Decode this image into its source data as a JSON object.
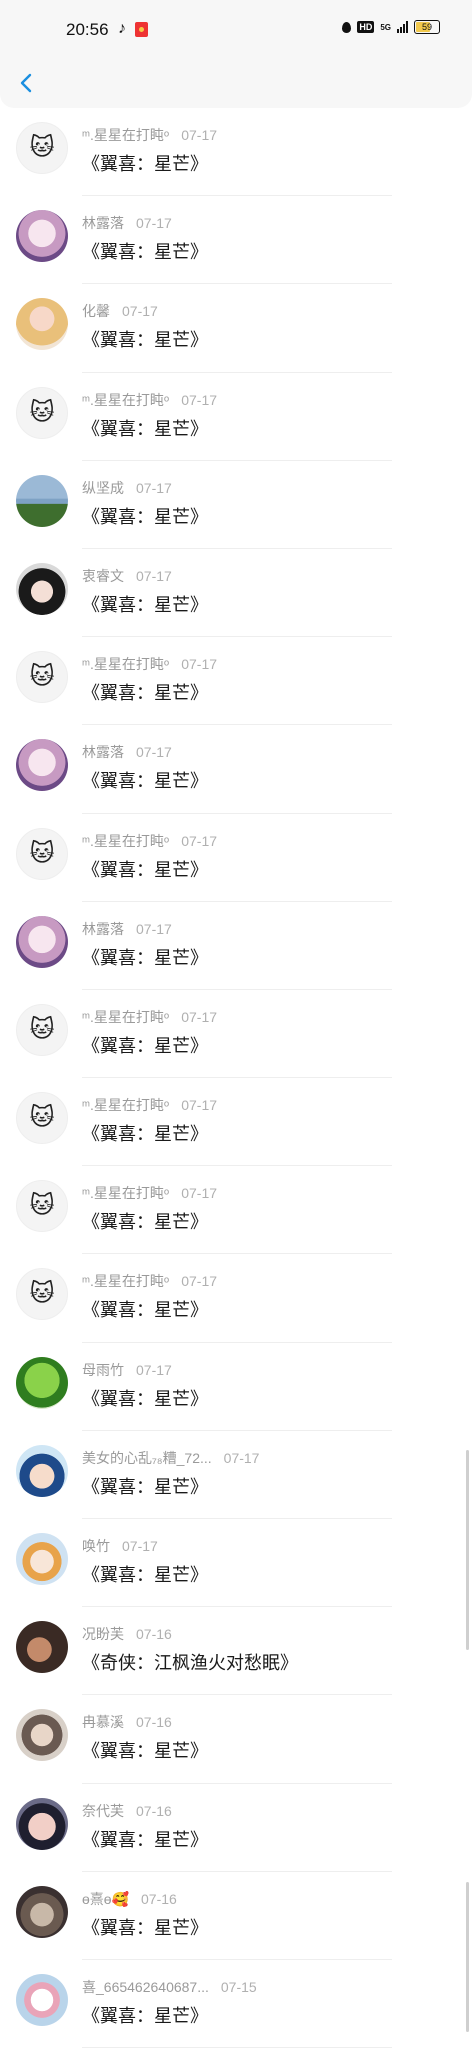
{
  "status_bar": {
    "time": "20:56",
    "hd": "HD",
    "network": "5G",
    "battery": "59"
  },
  "nav": {
    "back_icon": "chevron-left-icon",
    "accent": "#1a8fe0"
  },
  "items": [
    {
      "name": "ᵐ.星星在打盹ᵒ",
      "date": "07-17",
      "title": "《翼喜：星芒》",
      "avatar": "cat"
    },
    {
      "name": "林露落",
      "date": "07-17",
      "title": "《翼喜：星芒》",
      "avatar": "anime1"
    },
    {
      "name": "化馨",
      "date": "07-17",
      "title": "《翼喜：星芒》",
      "avatar": "blonde"
    },
    {
      "name": "ᵐ.星星在打盹ᵒ",
      "date": "07-17",
      "title": "《翼喜：星芒》",
      "avatar": "cat"
    },
    {
      "name": "纵坚成",
      "date": "07-17",
      "title": "《翼喜：星芒》",
      "avatar": "land"
    },
    {
      "name": "衷睿文",
      "date": "07-17",
      "title": "《翼喜：星芒》",
      "avatar": "anime2"
    },
    {
      "name": "ᵐ.星星在打盹ᵒ",
      "date": "07-17",
      "title": "《翼喜：星芒》",
      "avatar": "cat"
    },
    {
      "name": "林露落",
      "date": "07-17",
      "title": "《翼喜：星芒》",
      "avatar": "anime1"
    },
    {
      "name": "ᵐ.星星在打盹ᵒ",
      "date": "07-17",
      "title": "《翼喜：星芒》",
      "avatar": "cat"
    },
    {
      "name": "林露落",
      "date": "07-17",
      "title": "《翼喜：星芒》",
      "avatar": "anime1"
    },
    {
      "name": "ᵐ.星星在打盹ᵒ",
      "date": "07-17",
      "title": "《翼喜：星芒》",
      "avatar": "cat"
    },
    {
      "name": "ᵐ.星星在打盹ᵒ",
      "date": "07-17",
      "title": "《翼喜：星芒》",
      "avatar": "cat"
    },
    {
      "name": "ᵐ.星星在打盹ᵒ",
      "date": "07-17",
      "title": "《翼喜：星芒》",
      "avatar": "cat"
    },
    {
      "name": "ᵐ.星星在打盹ᵒ",
      "date": "07-17",
      "title": "《翼喜：星芒》",
      "avatar": "cat"
    },
    {
      "name": "母雨竹",
      "date": "07-17",
      "title": "《翼喜：星芒》",
      "avatar": "green"
    },
    {
      "name": "美女的心乱₇₈糟_72...",
      "date": "07-17",
      "title": "《翼喜：星芒》",
      "avatar": "boy"
    },
    {
      "name": "唤竹",
      "date": "07-17",
      "title": "《翼喜：星芒》",
      "avatar": "chibi"
    },
    {
      "name": "况盼芙",
      "date": "07-16",
      "title": "《奇侠：江枫渔火对愁眠》",
      "avatar": "hand"
    },
    {
      "name": "冉慕溪",
      "date": "07-16",
      "title": "《翼喜：星芒》",
      "avatar": "girl"
    },
    {
      "name": "奈代芙",
      "date": "07-16",
      "title": "《翼喜：星芒》",
      "avatar": "girl2"
    },
    {
      "name": "ɵ熹ɵ🥰",
      "date": "07-16",
      "title": "《翼喜：星芒》",
      "avatar": "cat2"
    },
    {
      "name": "喜_665462640687...",
      "date": "07-15",
      "title": "《翼喜：星芒》",
      "avatar": "anime3"
    }
  ]
}
